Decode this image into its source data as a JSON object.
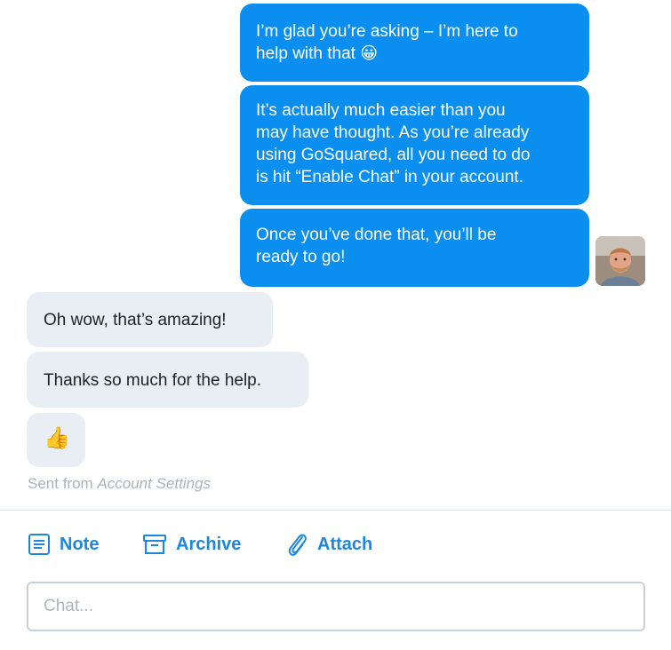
{
  "conversation": {
    "agent_messages": [
      {
        "text": "I’m glad you’re asking – I’m here to\nhelp with that 😀"
      },
      {
        "text": "It’s actually much easier than you\nmay have thought. As you’re already\nusing GoSquared, all you need to do\nis hit “Enable Chat” in your account."
      },
      {
        "text": "Once you’ve done that, you’ll be\nready to go!"
      }
    ],
    "visitor_messages": [
      {
        "text": "Oh wow, that’s amazing!"
      },
      {
        "text": "Thanks so much for the help."
      },
      {
        "text": "👍"
      }
    ],
    "sent_from": {
      "prefix": "Sent from ",
      "source": "Account Settings"
    }
  },
  "actions": {
    "note_label": "Note",
    "archive_label": "Archive",
    "attach_label": "Attach"
  },
  "composer": {
    "placeholder": "Chat..."
  },
  "colors": {
    "agent_bubble": "#0a8ff0",
    "visitor_bubble": "#e8eef3",
    "action_accent": "#1b87de"
  },
  "icons": [
    "note-icon",
    "archive-icon",
    "paperclip-icon",
    "avatar"
  ]
}
